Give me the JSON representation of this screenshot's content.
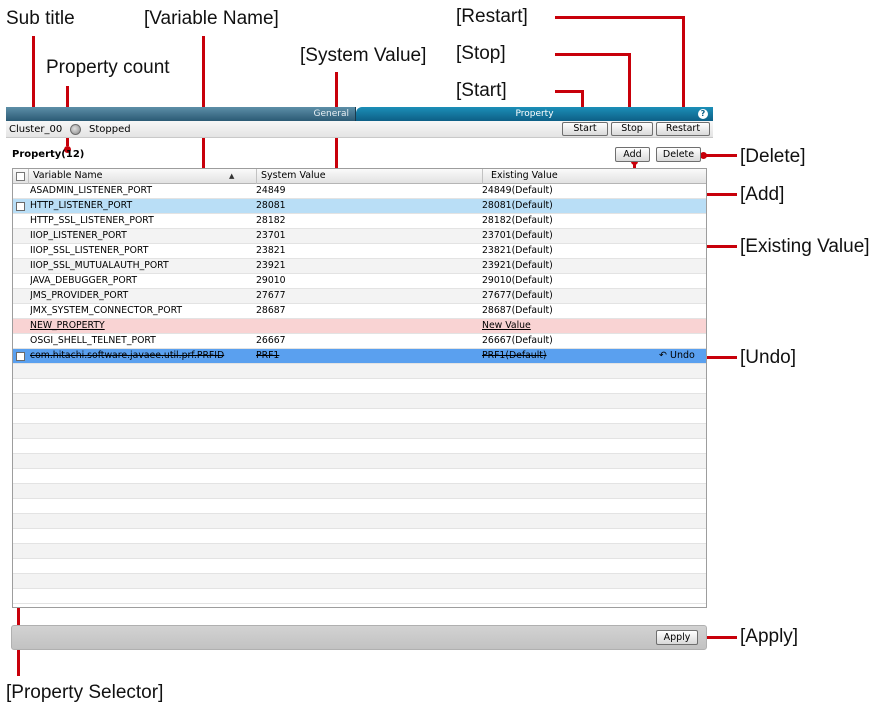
{
  "callouts": {
    "sub_title": "Sub title",
    "variable_name": "[Variable Name]",
    "restart": "[Restart]",
    "stop": "[Stop]",
    "system_value": "[System Value]",
    "property_count": "Property count",
    "start": "[Start]",
    "delete": "[Delete]",
    "add": "[Add]",
    "existing_value": "[Existing Value]",
    "undo": "[Undo]",
    "apply": "[Apply]",
    "property_selector": "[Property Selector]"
  },
  "tabs": {
    "general": "General",
    "property": "Property",
    "help": "?"
  },
  "status": {
    "cluster": "Cluster_00",
    "state": "Stopped"
  },
  "buttons": {
    "start": "Start",
    "stop": "Stop",
    "restart": "Restart",
    "add": "Add",
    "delete": "Delete",
    "apply": "Apply",
    "undo": "Undo"
  },
  "property_count": "Property(12)",
  "table": {
    "columns": [
      "Variable Name",
      "System Value",
      "Existing Value"
    ],
    "sort_indicator": "▲",
    "rows": [
      {
        "name": "ASADMIN_LISTENER_PORT",
        "system": "24849",
        "existing": "24849(Default)"
      },
      {
        "name": "HTTP_LISTENER_PORT",
        "system": "28081",
        "existing": "28081(Default)"
      },
      {
        "name": "HTTP_SSL_LISTENER_PORT",
        "system": "28182",
        "existing": "28182(Default)"
      },
      {
        "name": "IIOP_LISTENER_PORT",
        "system": "23701",
        "existing": "23701(Default)"
      },
      {
        "name": "IIOP_SSL_LISTENER_PORT",
        "system": "23821",
        "existing": "23821(Default)"
      },
      {
        "name": "IIOP_SSL_MUTUALAUTH_PORT",
        "system": "23921",
        "existing": "23921(Default)"
      },
      {
        "name": "JAVA_DEBUGGER_PORT",
        "system": "29010",
        "existing": "29010(Default)"
      },
      {
        "name": "JMS_PROVIDER_PORT",
        "system": "27677",
        "existing": "27677(Default)"
      },
      {
        "name": "JMX_SYSTEM_CONNECTOR_PORT",
        "system": "28687",
        "existing": "28687(Default)"
      },
      {
        "name": "NEW_PROPERTY",
        "system": "",
        "existing": "New Value"
      },
      {
        "name": "OSGI_SHELL_TELNET_PORT",
        "system": "26667",
        "existing": "26667(Default)"
      },
      {
        "name": "com.hitachi.software.javaee.util.prf.PRFID",
        "system": "PRF1",
        "existing": "PRF1(Default)"
      }
    ]
  },
  "colors": {
    "annotation": "#c8000a",
    "selected_row": "#b9def6",
    "new_row": "#f9d3d3",
    "deleted_row": "#5aa0ef",
    "tab_active": "#1c8fb8"
  }
}
